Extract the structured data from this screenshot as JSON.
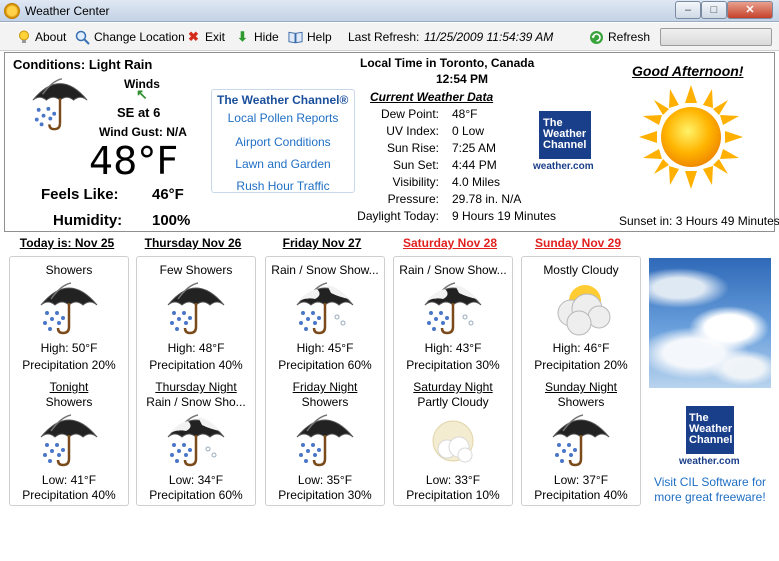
{
  "window": {
    "title": "Weather Center",
    "min": "–",
    "max": "□",
    "close": "✕"
  },
  "toolbar": {
    "about": "About",
    "change_location": "Change Location",
    "exit": "Exit",
    "hide": "Hide",
    "help": "Help",
    "last_refresh_label": "Last Refresh:",
    "last_refresh_value": "11/25/2009 11:54:39 AM",
    "refresh": "Refresh"
  },
  "current": {
    "conditions": "Conditions: Light Rain",
    "winds_label": "Winds",
    "winds_value": "SE at 6",
    "wind_gust": "Wind Gust:  N/A",
    "temperature": "48°F",
    "feels_like_label": "Feels Like:",
    "feels_like_value": "46°F",
    "humidity_label": "Humidity:",
    "humidity_value": "100%"
  },
  "twc_box": {
    "heading": "The Weather Channel®",
    "links": [
      "Local Pollen Reports",
      "Airport Conditions",
      "Lawn and Garden",
      "Rush Hour Traffic"
    ]
  },
  "local_time": {
    "label": "Local Time in Toronto, Canada",
    "time": "12:54 PM"
  },
  "current_data": {
    "heading": "Current Weather Data",
    "rows": [
      {
        "label": "Dew Point:",
        "value": "48°F"
      },
      {
        "label": "UV Index:",
        "value": "0 Low"
      },
      {
        "label": "Sun Rise:",
        "value": "7:25 AM"
      },
      {
        "label": "Sun Set:",
        "value": "4:44 PM"
      },
      {
        "label": "Visibility:",
        "value": "4.0 Miles"
      },
      {
        "label": "Pressure:",
        "value": "29.78 in. N/A"
      },
      {
        "label": "Daylight Today:",
        "value": "9 Hours 19 Minutes"
      }
    ]
  },
  "logo": {
    "line1": "The",
    "line2": "Weather",
    "line3": "Channel",
    "url": "weather.com"
  },
  "greeting": "Good Afternoon!",
  "sunset_in": "Sunset in: 3 Hours 49 Minutes",
  "forecast": [
    {
      "day": "Today is: Nov 25",
      "weekend": false,
      "cond": "Showers",
      "icon": "rain",
      "high": "High: 50°F",
      "precip": "Precipitation 20%",
      "night_label": "Tonight",
      "night_cond": "Showers",
      "night_icon": "rain",
      "low": "Low: 41°F",
      "night_precip": "Precipitation 40%"
    },
    {
      "day": "Thursday Nov 26",
      "weekend": false,
      "cond": "Few Showers",
      "icon": "rain",
      "high": "High: 48°F",
      "precip": "Precipitation 40%",
      "night_label": "Thursday Night",
      "night_cond": "Rain / Snow Sho...",
      "night_icon": "rain-snow",
      "low": "Low: 34°F",
      "night_precip": "Precipitation 60%"
    },
    {
      "day": "Friday Nov 27",
      "weekend": false,
      "cond": "Rain / Snow Show...",
      "icon": "rain-snow",
      "high": "High: 45°F",
      "precip": "Precipitation 60%",
      "night_label": "Friday Night",
      "night_cond": "Showers",
      "night_icon": "rain",
      "low": "Low: 35°F",
      "night_precip": "Precipitation 30%"
    },
    {
      "day": "Saturday Nov 28",
      "weekend": true,
      "cond": "Rain / Snow Show...",
      "icon": "rain-snow",
      "high": "High: 43°F",
      "precip": "Precipitation 30%",
      "night_label": "Saturday Night",
      "night_cond": "Partly Cloudy",
      "night_icon": "partly-cloudy-night",
      "low": "Low: 33°F",
      "night_precip": "Precipitation 10%"
    },
    {
      "day": "Sunday Nov 29",
      "weekend": true,
      "cond": "Mostly Cloudy",
      "icon": "mostly-cloudy",
      "high": "High: 46°F",
      "precip": "Precipitation 20%",
      "night_label": "Sunday Night",
      "night_cond": "Showers",
      "night_icon": "rain",
      "low": "Low: 37°F",
      "night_precip": "Precipitation 40%"
    }
  ],
  "cil_link": {
    "line1": "Visit CIL Software for",
    "line2": "more great freeware!"
  },
  "colors": {
    "weekend": "#e0211f",
    "link": "#1f6fc4",
    "twc_blue": "#1a3f8a"
  }
}
